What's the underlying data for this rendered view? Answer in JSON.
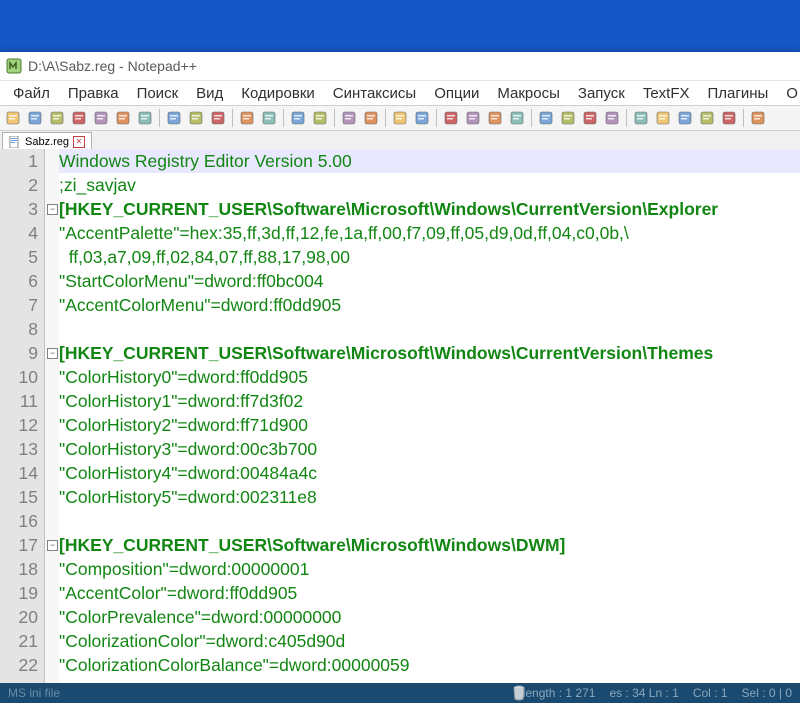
{
  "window": {
    "title": "D:\\A\\Sabz.reg - Notepad++"
  },
  "menu": {
    "items": [
      "Файл",
      "Правка",
      "Поиск",
      "Вид",
      "Кодировки",
      "Синтаксисы",
      "Опции",
      "Макросы",
      "Запуск",
      "TextFX",
      "Плагины",
      "О"
    ]
  },
  "tab": {
    "label": "Sabz.reg"
  },
  "code": {
    "lines": [
      {
        "n": 1,
        "cls": "k-green hl-current",
        "text": "Windows Registry Editor Version 5.00"
      },
      {
        "n": 2,
        "cls": "k-green",
        "text": ";zi_savjav"
      },
      {
        "n": 3,
        "cls": "k-greenb",
        "text": "[HKEY_CURRENT_USER\\Software\\Microsoft\\Windows\\CurrentVersion\\Explorer"
      },
      {
        "n": 4,
        "cls": "k-green",
        "text": "\"AccentPalette\"=hex:35,ff,3d,ff,12,fe,1a,ff,00,f7,09,ff,05,d9,0d,ff,04,c0,0b,\\"
      },
      {
        "n": 5,
        "cls": "k-green",
        "text": "  ff,03,a7,09,ff,02,84,07,ff,88,17,98,00"
      },
      {
        "n": 6,
        "cls": "k-green",
        "text": "\"StartColorMenu\"=dword:ff0bc004"
      },
      {
        "n": 7,
        "cls": "k-green",
        "text": "\"AccentColorMenu\"=dword:ff0dd905"
      },
      {
        "n": 8,
        "cls": "",
        "text": " "
      },
      {
        "n": 9,
        "cls": "k-greenb",
        "text": "[HKEY_CURRENT_USER\\Software\\Microsoft\\Windows\\CurrentVersion\\Themes"
      },
      {
        "n": 10,
        "cls": "k-green",
        "text": "\"ColorHistory0\"=dword:ff0dd905"
      },
      {
        "n": 11,
        "cls": "k-green",
        "text": "\"ColorHistory1\"=dword:ff7d3f02"
      },
      {
        "n": 12,
        "cls": "k-green",
        "text": "\"ColorHistory2\"=dword:ff71d900"
      },
      {
        "n": 13,
        "cls": "k-green",
        "text": "\"ColorHistory3\"=dword:00c3b700"
      },
      {
        "n": 14,
        "cls": "k-green",
        "text": "\"ColorHistory4\"=dword:00484a4c"
      },
      {
        "n": 15,
        "cls": "k-green",
        "text": "\"ColorHistory5\"=dword:002311e8"
      },
      {
        "n": 16,
        "cls": "",
        "text": " "
      },
      {
        "n": 17,
        "cls": "k-greenb",
        "text": "[HKEY_CURRENT_USER\\Software\\Microsoft\\Windows\\DWM]"
      },
      {
        "n": 18,
        "cls": "k-green",
        "text": "\"Composition\"=dword:00000001"
      },
      {
        "n": 19,
        "cls": "k-green",
        "text": "\"AccentColor\"=dword:ff0dd905"
      },
      {
        "n": 20,
        "cls": "k-green",
        "text": "\"ColorPrevalence\"=dword:00000000"
      },
      {
        "n": 21,
        "cls": "k-green",
        "text": "\"ColorizationColor\"=dword:c405d90d"
      },
      {
        "n": 22,
        "cls": "k-green",
        "text": "\"ColorizationColorBalance\"=dword:00000059"
      }
    ],
    "fold_rows": [
      3,
      9,
      17
    ]
  },
  "status": {
    "left": "MS ini file",
    "length": "length : 1 271",
    "lines": "es : 34 Ln : 1",
    "col": "Col : 1",
    "sel": "Sel : 0 | 0"
  },
  "toolbar_icons": [
    "new-file-icon",
    "open-file-icon",
    "save-icon",
    "save-all-icon",
    "close-icon",
    "close-all-icon",
    "print-icon",
    "sep",
    "cut-icon",
    "copy-icon",
    "paste-icon",
    "sep",
    "undo-icon",
    "redo-icon",
    "sep",
    "find-icon",
    "replace-icon",
    "sep",
    "zoom-in-icon",
    "zoom-out-icon",
    "sep",
    "sync-v-icon",
    "sync-h-icon",
    "sep",
    "wrap-icon",
    "show-chars-icon",
    "indent-guide-icon",
    "lang-icon",
    "sep",
    "folder-icon",
    "doc-map-icon",
    "func-list-icon",
    "monitor-icon",
    "sep",
    "record-macro-icon",
    "stop-macro-icon",
    "play-macro-icon",
    "play-multi-icon",
    "save-macro-icon",
    "sep",
    "spellcheck-icon"
  ],
  "colors": {
    "accent": "#1657c7",
    "code_green": "#128612"
  }
}
